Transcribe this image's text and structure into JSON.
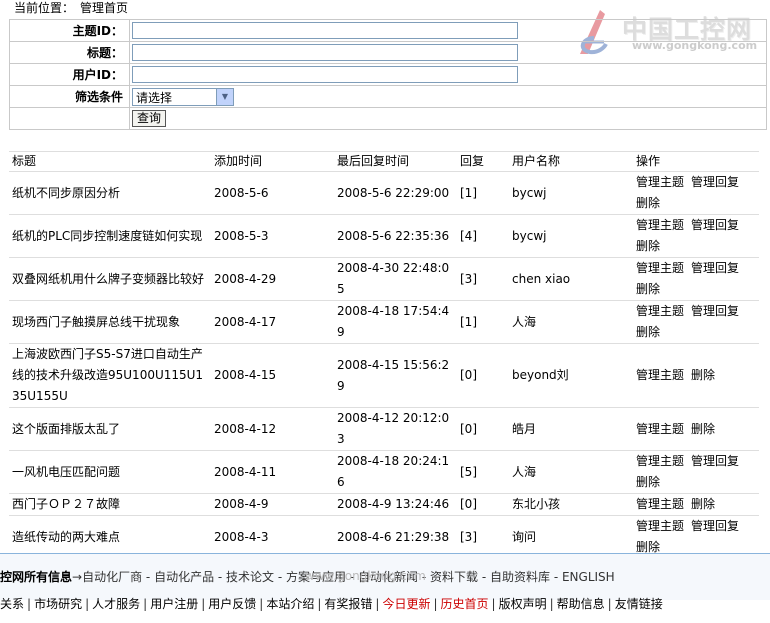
{
  "breadcrumb": {
    "label": "当前位置：",
    "current": "管理首页"
  },
  "logo": {
    "name_cn": "中国工控网",
    "url": "www.gongkong.com"
  },
  "search": {
    "topic_id_label": "主题ID：",
    "title_label": "标题：",
    "user_id_label": "用户ID：",
    "filter_label": "筛选条件",
    "filter_value": "请选择",
    "query_button": "查询"
  },
  "table": {
    "headers": [
      "标题",
      "添加时间",
      "最后回复时间",
      "回复",
      "用户名称",
      "操作"
    ],
    "rows": [
      {
        "title": "纸机不同步原因分析",
        "added": "2008-5-6",
        "last_reply": "2008-5-6 22:29:00",
        "replies": "[1]",
        "user": "bycwj",
        "actions": [
          "管理主题",
          "管理回复",
          "删除"
        ]
      },
      {
        "title": "纸机的PLC同步控制速度链如何实现",
        "added": "2008-5-3",
        "last_reply": "2008-5-6 22:35:36",
        "replies": "[4]",
        "user": "bycwj",
        "actions": [
          "管理主题",
          "管理回复",
          "删除"
        ]
      },
      {
        "title": "双叠网纸机用什么牌子变频器比较好",
        "added": "2008-4-29",
        "last_reply": "2008-4-30 22:48:05",
        "replies": "[3]",
        "user": "chen xiao",
        "actions": [
          "管理主题",
          "管理回复",
          "删除"
        ]
      },
      {
        "title": "现场西门子触摸屏总线干扰现象",
        "added": "2008-4-17",
        "last_reply": "2008-4-18 17:54:49",
        "replies": "[1]",
        "user": "人海",
        "actions": [
          "管理主题",
          "管理回复",
          "删除"
        ]
      },
      {
        "title": "上海波欧西门子S5-S7进口自动生产线的技术升级改造95U100U115U135U155U",
        "added": "2008-4-15",
        "last_reply": "2008-4-15 15:56:29",
        "replies": "[0]",
        "user": "beyond刘",
        "actions": [
          "管理主题",
          "删除"
        ]
      },
      {
        "title": "这个版面排版太乱了",
        "added": "2008-4-12",
        "last_reply": "2008-4-12 20:12:03",
        "replies": "[0]",
        "user": "皓月",
        "actions": [
          "管理主题",
          "删除"
        ]
      },
      {
        "title": "一风机电压匹配问题",
        "added": "2008-4-11",
        "last_reply": "2008-4-18 20:24:16",
        "replies": "[5]",
        "user": "人海",
        "actions": [
          "管理主题",
          "管理回复",
          "删除"
        ]
      },
      {
        "title": "西门子ＯＰ２７故障",
        "added": "2008-4-9",
        "last_reply": "2008-4-9 13:24:46",
        "replies": "[0]",
        "user": "东北小孩",
        "actions": [
          "管理主题",
          "删除"
        ]
      },
      {
        "title": "造纸传动的两大难点",
        "added": "2008-4-3",
        "last_reply": "2008-4-6 21:29:38",
        "replies": "[3]",
        "user": "询问",
        "actions": [
          "管理主题",
          "管理回复",
          "删除"
        ]
      }
    ]
  },
  "footer": {
    "site_label": "控网所有信息",
    "arrow": "→",
    "nav": [
      "自动化厂商",
      "自动化产品",
      "技术论文",
      "方案与应用",
      "自动化新闻",
      "资料下载",
      "自助资料库",
      "ENGLISH"
    ],
    "watermark": "www.gongkong.com",
    "links": [
      {
        "text": "关系",
        "hl": false
      },
      {
        "text": "市场研究",
        "hl": false
      },
      {
        "text": "人才服务",
        "hl": false
      },
      {
        "text": "用户注册",
        "hl": false
      },
      {
        "text": "用户反馈",
        "hl": false
      },
      {
        "text": "本站介绍",
        "hl": false
      },
      {
        "text": "有奖报错",
        "hl": false
      },
      {
        "text": "今日更新",
        "hl": true
      },
      {
        "text": "历史首页",
        "hl": true
      },
      {
        "text": "版权声明",
        "hl": false
      },
      {
        "text": "帮助信息",
        "hl": false
      },
      {
        "text": "友情链接",
        "hl": false
      }
    ],
    "link_highlight_color": "#cc0000"
  }
}
